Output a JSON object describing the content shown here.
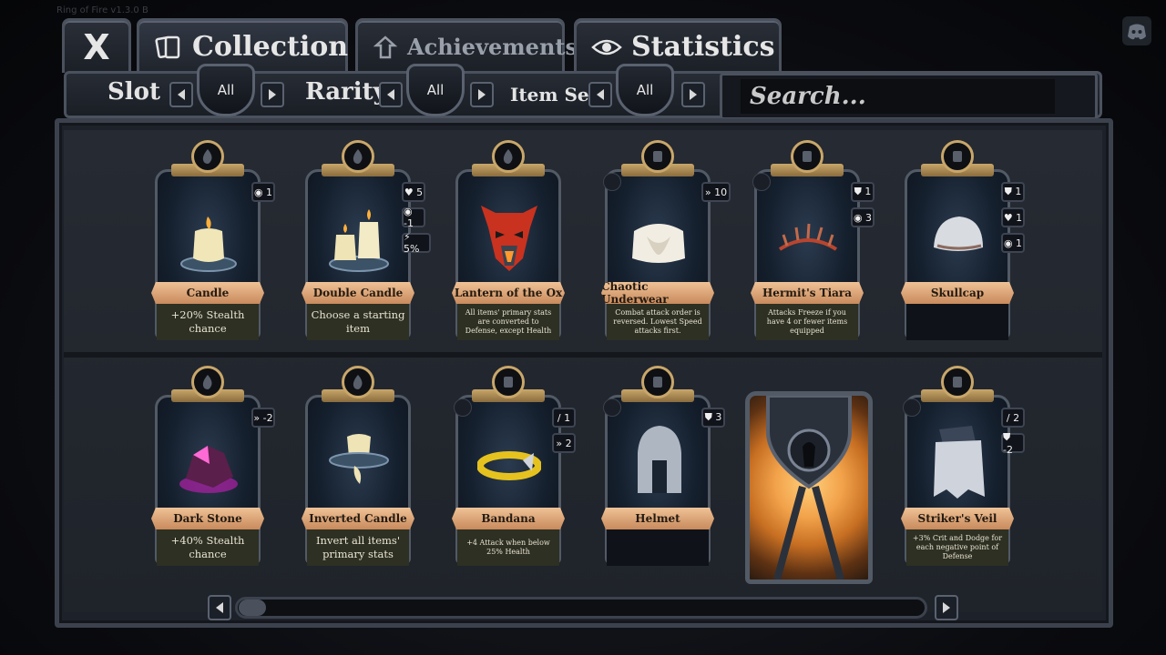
{
  "app": {
    "version_text": "Ring of Fire v1.3.0 B"
  },
  "tabs": {
    "close_label": "X",
    "collection_label": "Collection",
    "achievements_label": "Achievements",
    "statistics_label": "Statistics"
  },
  "filters": {
    "slot_label": "Slot",
    "slot_value": "All",
    "rarity_label": "Rarity",
    "rarity_value": "All",
    "itemset_label": "Item Set:",
    "itemset_value": "All"
  },
  "search": {
    "placeholder": "Search..."
  },
  "cards": [
    {
      "name": "Candle",
      "desc": "+20% Stealth chance",
      "badges": [
        "◉ 1"
      ]
    },
    {
      "name": "Double Candle",
      "desc": "Choose a starting item",
      "badges": [
        "♥ 5",
        "◉ -1",
        "⚡ 5%"
      ]
    },
    {
      "name": "Lantern of the Ox",
      "desc": "All items' primary stats are converted to Defense, except Health",
      "badges": []
    },
    {
      "name": "Chaotic Underwear",
      "desc": "Combat attack order is reversed. Lowest Speed attacks first.",
      "badges": [
        "» 10"
      ]
    },
    {
      "name": "Hermit's Tiara",
      "desc": "Attacks Freeze if you have 4 or fewer items equipped",
      "badges": [
        "⛊ 1",
        "◉ 3"
      ]
    },
    {
      "name": "Skullcap",
      "desc": "",
      "badges": [
        "⛊ 1",
        "♥ 1",
        "◉ 1"
      ]
    },
    {
      "name": "Dark Stone",
      "desc": "+40% Stealth chance",
      "badges": [
        "» -2"
      ]
    },
    {
      "name": "Inverted Candle",
      "desc": "Invert all items' primary stats",
      "badges": []
    },
    {
      "name": "Bandana",
      "desc": "+4 Attack when below 25% Health",
      "badges": [
        "/ 1",
        "» 2"
      ]
    },
    {
      "name": "Helmet",
      "desc": "",
      "badges": [
        "⛊ 3"
      ]
    },
    {
      "name": "Striker's Veil",
      "desc": "+3% Crit and Dodge for each negative point of Defense",
      "badges": [
        "/ 2",
        "⛊ -2"
      ]
    }
  ],
  "colors": {
    "gold": "#c9a76a",
    "name_plate": "#e0a878",
    "panel": "#1d2129"
  }
}
